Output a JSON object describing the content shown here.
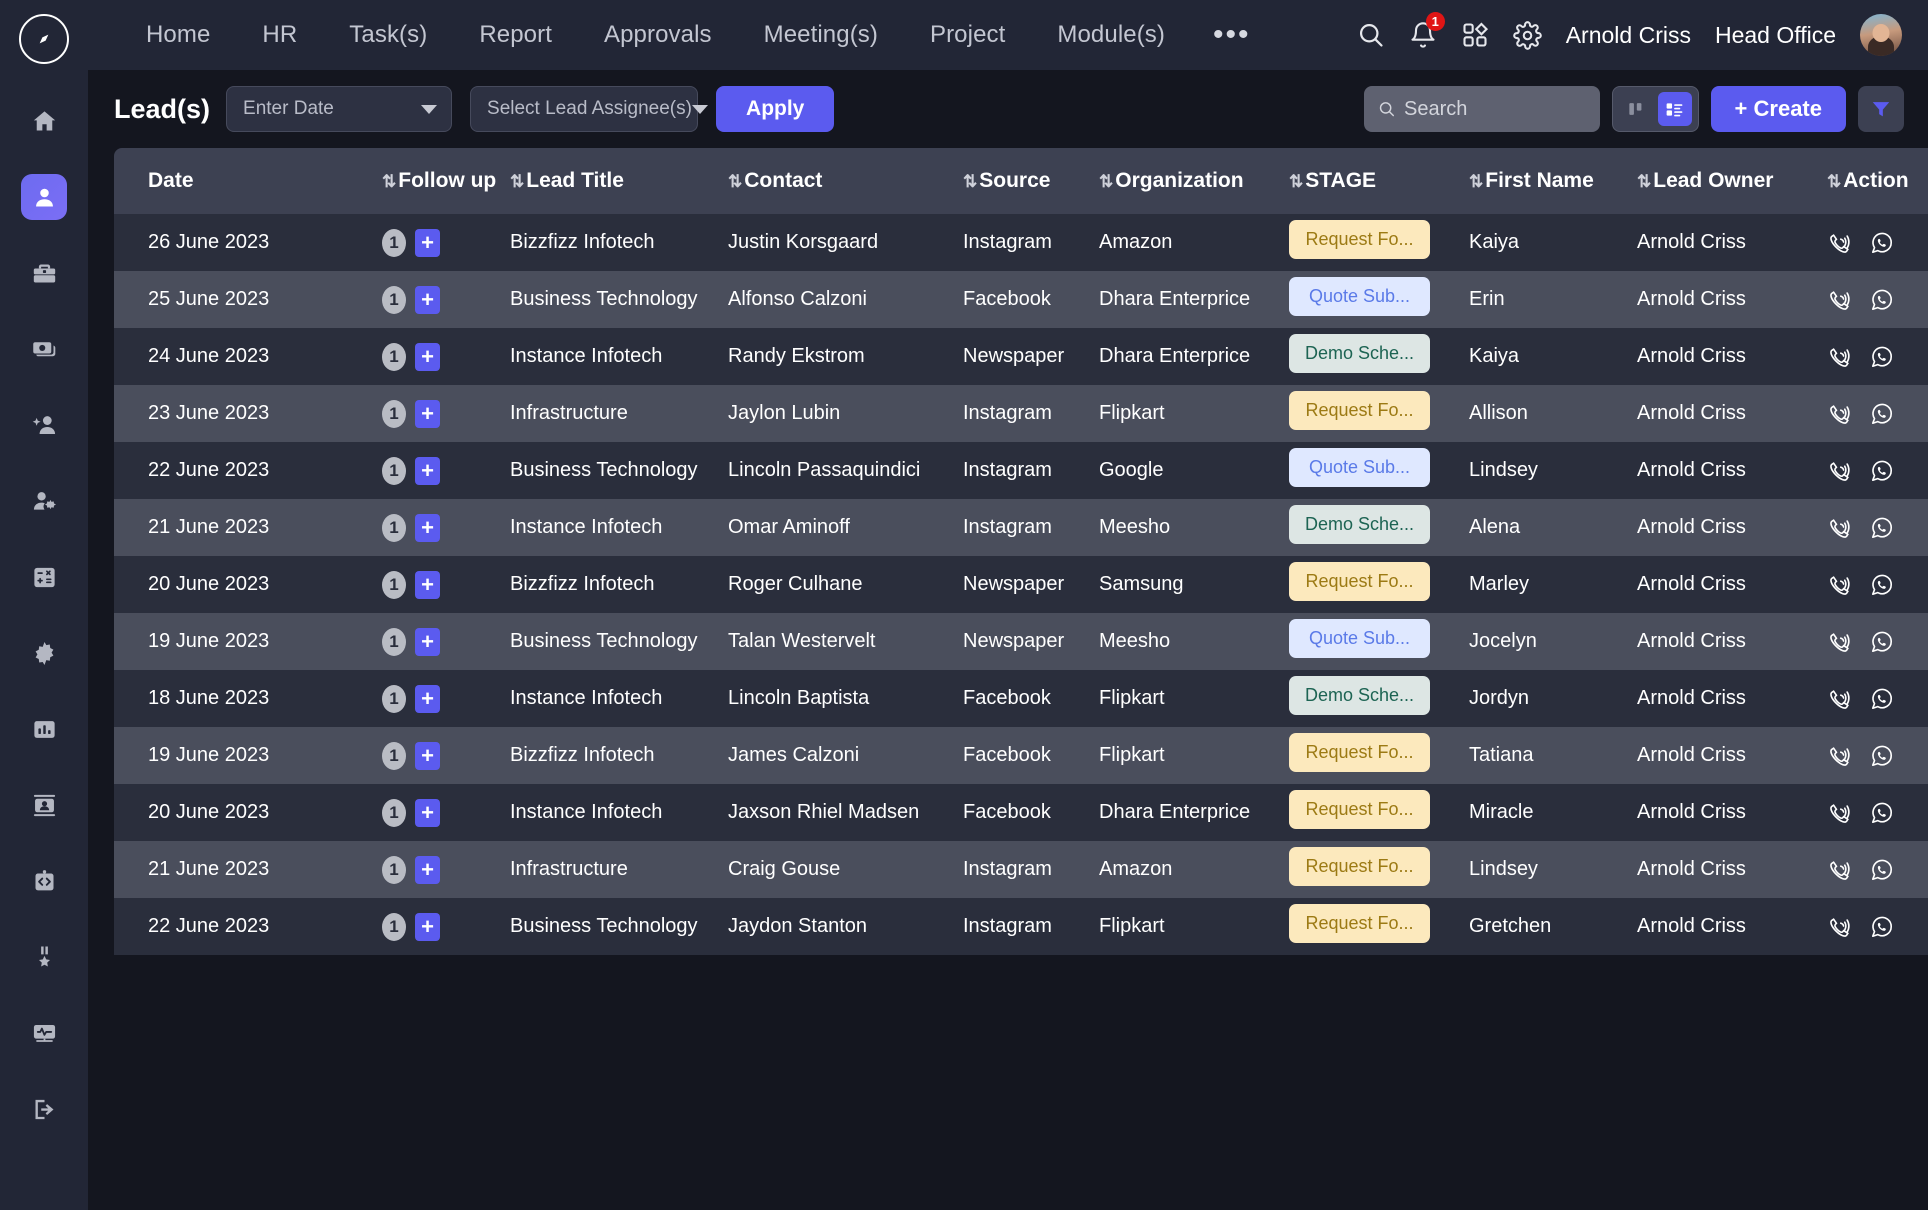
{
  "brand": {
    "logo_icon": "compass-logo-icon"
  },
  "sidebar": {
    "items": [
      {
        "icon": "home-icon",
        "name": "sidebar-item-home",
        "active": false
      },
      {
        "icon": "person-icon",
        "name": "sidebar-item-leads",
        "active": true
      },
      {
        "icon": "briefcase-icon",
        "name": "sidebar-item-projects",
        "active": false
      },
      {
        "icon": "money-icon",
        "name": "sidebar-item-finance",
        "active": false
      },
      {
        "icon": "add-person-icon",
        "name": "sidebar-item-add-user",
        "active": false
      },
      {
        "icon": "person-settings-icon",
        "name": "sidebar-item-user-admin",
        "active": false
      },
      {
        "icon": "calculator-icon",
        "name": "sidebar-item-calculator",
        "active": false
      },
      {
        "icon": "gear-icon",
        "name": "sidebar-item-settings",
        "active": false
      },
      {
        "icon": "bar-chart-icon",
        "name": "sidebar-item-reports",
        "active": false
      },
      {
        "icon": "contact-card-icon",
        "name": "sidebar-item-contacts",
        "active": false
      },
      {
        "icon": "code-clipboard-icon",
        "name": "sidebar-item-developer",
        "active": false
      },
      {
        "icon": "medal-icon",
        "name": "sidebar-item-awards",
        "active": false
      },
      {
        "icon": "monitor-activity-icon",
        "name": "sidebar-item-monitoring",
        "active": false
      },
      {
        "icon": "logout-icon",
        "name": "sidebar-item-logout",
        "active": false
      }
    ]
  },
  "topbar": {
    "nav": [
      {
        "label": "Home"
      },
      {
        "label": "HR"
      },
      {
        "label": "Task(s)"
      },
      {
        "label": "Report"
      },
      {
        "label": "Approvals"
      },
      {
        "label": "Meeting(s)"
      },
      {
        "label": "Project"
      },
      {
        "label": "Module(s)"
      }
    ],
    "more_label": "•••",
    "icons": [
      {
        "icon": "search-icon"
      },
      {
        "icon": "bell-icon",
        "badge": "1"
      },
      {
        "icon": "apps-grid-icon"
      },
      {
        "icon": "gear-icon"
      }
    ],
    "notification_count": "1",
    "user_name": "Arnold Criss",
    "office_name": "Head Office",
    "avatar_icon": "user-avatar"
  },
  "filterbar": {
    "page_title": "Lead(s)",
    "date_filter": {
      "value": "Enter Date",
      "placeholder": "Enter Date"
    },
    "assignee_filter": {
      "value": "Select Lead Assignee(s)",
      "placeholder": "Select Lead Assignee(s)"
    },
    "apply_label": "Apply",
    "search": {
      "value": "",
      "placeholder": "Search"
    },
    "view_kanban": "kanban-view-icon",
    "view_list": "list-view-icon",
    "active_view": "list",
    "create_label": "+ Create",
    "filter_icon": "funnel-filter-icon"
  },
  "table": {
    "columns": [
      {
        "label": "Date",
        "sortable": false
      },
      {
        "label": "Follow up",
        "sortable": true
      },
      {
        "label": "Lead Title",
        "sortable": true
      },
      {
        "label": "Contact",
        "sortable": true
      },
      {
        "label": "Source",
        "sortable": true
      },
      {
        "label": "Organization",
        "sortable": true
      },
      {
        "label": "STAGE",
        "sortable": true
      },
      {
        "label": "First Name",
        "sortable": true
      },
      {
        "label": "Lead Owner",
        "sortable": true
      },
      {
        "label": "Action",
        "sortable": true
      }
    ],
    "sort_glyph": "⇅",
    "followup_add_glyph": "+",
    "rows": [
      {
        "date": "26 June 2023",
        "followup_count": "1",
        "lead_title": "Bizzfizz Infotech",
        "contact": "Justin Korsgaard",
        "source": "Instagram",
        "organization": "Amazon",
        "stage": "Request Fo...",
        "stage_type": "amber",
        "first_name": "Kaiya",
        "lead_owner": "Arnold Criss"
      },
      {
        "date": "25 June 2023",
        "followup_count": "1",
        "lead_title": "Business Technology",
        "contact": "Alfonso Calzoni",
        "source": "Facebook",
        "organization": "Dhara Enterprice",
        "stage": "Quote Sub...",
        "stage_type": "blue",
        "first_name": "Erin",
        "lead_owner": "Arnold Criss"
      },
      {
        "date": "24 June 2023",
        "followup_count": "1",
        "lead_title": "Instance Infotech",
        "contact": "Randy Ekstrom",
        "source": "Newspaper",
        "organization": "Dhara Enterprice",
        "stage": "Demo Sche...",
        "stage_type": "teal",
        "first_name": "Kaiya",
        "lead_owner": "Arnold Criss"
      },
      {
        "date": "23 June 2023",
        "followup_count": "1",
        "lead_title": "Infrastructure",
        "contact": "Jaylon Lubin",
        "source": "Instagram",
        "organization": "Flipkart",
        "stage": "Request Fo...",
        "stage_type": "amber",
        "first_name": "Allison",
        "lead_owner": "Arnold Criss"
      },
      {
        "date": "22 June 2023",
        "followup_count": "1",
        "lead_title": "Business Technology",
        "contact": "Lincoln Passaquindici",
        "source": "Instagram",
        "organization": "Google",
        "stage": "Quote Sub...",
        "stage_type": "blue",
        "first_name": "Lindsey",
        "lead_owner": "Arnold Criss"
      },
      {
        "date": "21 June 2023",
        "followup_count": "1",
        "lead_title": "Instance Infotech",
        "contact": "Omar Aminoff",
        "source": "Instagram",
        "organization": "Meesho",
        "stage": "Demo Sche...",
        "stage_type": "teal",
        "first_name": "Alena",
        "lead_owner": "Arnold Criss"
      },
      {
        "date": "20 June 2023",
        "followup_count": "1",
        "lead_title": "Bizzfizz Infotech",
        "contact": "Roger Culhane",
        "source": "Newspaper",
        "organization": "Samsung",
        "stage": "Request Fo...",
        "stage_type": "amber",
        "first_name": "Marley",
        "lead_owner": "Arnold Criss"
      },
      {
        "date": "19 June 2023",
        "followup_count": "1",
        "lead_title": "Business Technology",
        "contact": "Talan Westervelt",
        "source": "Newspaper",
        "organization": "Meesho",
        "stage": "Quote Sub...",
        "stage_type": "blue",
        "first_name": "Jocelyn",
        "lead_owner": "Arnold Criss"
      },
      {
        "date": "18 June 2023",
        "followup_count": "1",
        "lead_title": "Instance Infotech",
        "contact": "Lincoln Baptista",
        "source": "Facebook",
        "organization": "Flipkart",
        "stage": "Demo Sche...",
        "stage_type": "teal",
        "first_name": "Jordyn",
        "lead_owner": "Arnold Criss"
      },
      {
        "date": "19 June 2023",
        "followup_count": "1",
        "lead_title": "Bizzfizz Infotech",
        "contact": "James Calzoni",
        "source": "Facebook",
        "organization": "Flipkart",
        "stage": "Request Fo...",
        "stage_type": "amber",
        "first_name": "Tatiana",
        "lead_owner": "Arnold Criss"
      },
      {
        "date": "20 June 2023",
        "followup_count": "1",
        "lead_title": "Instance Infotech",
        "contact": "Jaxson Rhiel Madsen",
        "source": "Facebook",
        "organization": "Dhara Enterprice",
        "stage": "Request Fo...",
        "stage_type": "amber",
        "first_name": "Miracle",
        "lead_owner": "Arnold Criss"
      },
      {
        "date": "21 June 2023",
        "followup_count": "1",
        "lead_title": "Infrastructure",
        "contact": "Craig Gouse",
        "source": "Instagram",
        "organization": "Amazon",
        "stage": "Request Fo...",
        "stage_type": "amber",
        "first_name": "Lindsey",
        "lead_owner": "Arnold Criss"
      },
      {
        "date": "22 June 2023",
        "followup_count": "1",
        "lead_title": "Business Technology",
        "contact": "Jaydon Stanton",
        "source": "Instagram",
        "organization": "Flipkart",
        "stage": "Request Fo...",
        "stage_type": "amber",
        "first_name": "Gretchen",
        "lead_owner": "Arnold Criss"
      }
    ],
    "action_icons": [
      "phone-call-icon",
      "whatsapp-icon"
    ]
  },
  "colors": {
    "accent": "#5b5bef",
    "sidebar_bg": "#222636",
    "page_bg": "#14161f",
    "row_odd": "#2a2e3c",
    "row_even": "#4a4e5c",
    "header_row": "#3d4152",
    "badge_amber_bg": "#fce9bd",
    "badge_amber_fg": "#9c7a14",
    "badge_blue_bg": "#dfe8ff",
    "badge_blue_fg": "#5a7ae8",
    "badge_teal_bg": "#dde6e4",
    "badge_teal_fg": "#1d6453",
    "notification_red": "#e01515"
  }
}
